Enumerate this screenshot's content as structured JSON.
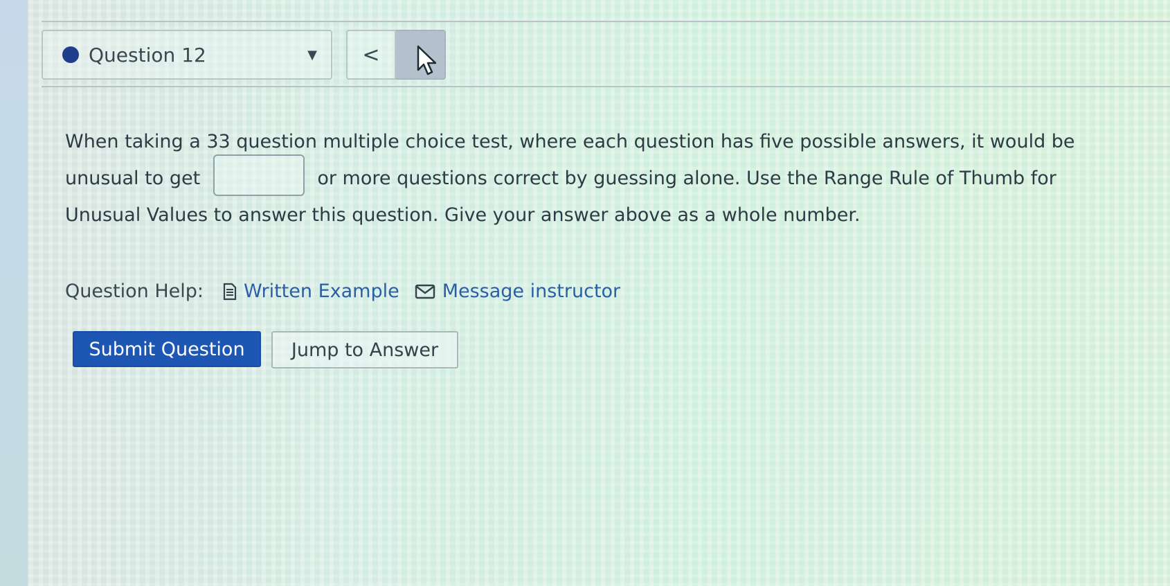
{
  "header": {
    "question_select_label": "Question 12",
    "prev_label": "<"
  },
  "question": {
    "text_before": "When taking a 33 question multiple choice test, where each question has five possible answers, it would be unusual to get",
    "answer_value": "",
    "text_after": "or more questions correct by guessing alone. Use the Range Rule of Thumb for Unusual Values to answer this question. Give your answer above as a whole number."
  },
  "help": {
    "label": "Question Help:",
    "written_example": "Written Example",
    "message_instructor": "Message instructor"
  },
  "buttons": {
    "submit": "Submit Question",
    "jump": "Jump to Answer"
  },
  "colors": {
    "accent": "#1e56b3",
    "link": "#2a5fa6",
    "status_dot": "#1f3f8c"
  }
}
